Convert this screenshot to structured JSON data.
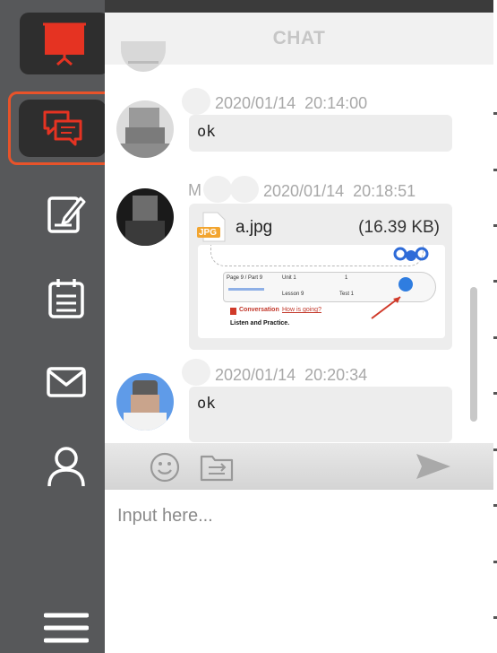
{
  "header": {
    "title": "CHAT"
  },
  "sidebar": {
    "items": [
      {
        "name": "whiteboard",
        "icon": "presentation-board-icon",
        "active": false
      },
      {
        "name": "chat",
        "icon": "chat-bubbles-icon",
        "active": true
      },
      {
        "name": "notes",
        "icon": "edit-note-icon",
        "active": false
      },
      {
        "name": "calendar",
        "icon": "calendar-icon",
        "active": false
      },
      {
        "name": "mail",
        "icon": "envelope-icon",
        "active": false
      },
      {
        "name": "profile",
        "icon": "user-icon",
        "active": false
      },
      {
        "name": "menu",
        "icon": "hamburger-menu-icon",
        "active": false
      }
    ]
  },
  "messages": [
    {
      "sender": "",
      "timestamp": "2020/01/14  20:14:00",
      "text": "ok"
    },
    {
      "sender": "M",
      "timestamp": "2020/01/14  20:18:51",
      "file": {
        "name": "a.jpg",
        "size": "(16.39 KB)",
        "badge": "JPG",
        "preview": {
          "cells": [
            "Page 9 / Part 9",
            "Unit 1",
            "1",
            "Lesson 9",
            "Test 1"
          ],
          "link_title": "Conversation",
          "link_sub": "How is going?",
          "body": "Listen and Practice."
        }
      }
    },
    {
      "sender": "",
      "timestamp": "2020/01/14  20:20:34",
      "text": "ok"
    }
  ],
  "composer": {
    "placeholder": "Input here...",
    "icons": [
      "emoji-icon",
      "folder-icon",
      "send-icon"
    ]
  },
  "colors": {
    "sidebar_bg": "#57585a",
    "accent": "#e8532a",
    "active_red": "#e53935",
    "bubble_bg": "#ededed"
  }
}
